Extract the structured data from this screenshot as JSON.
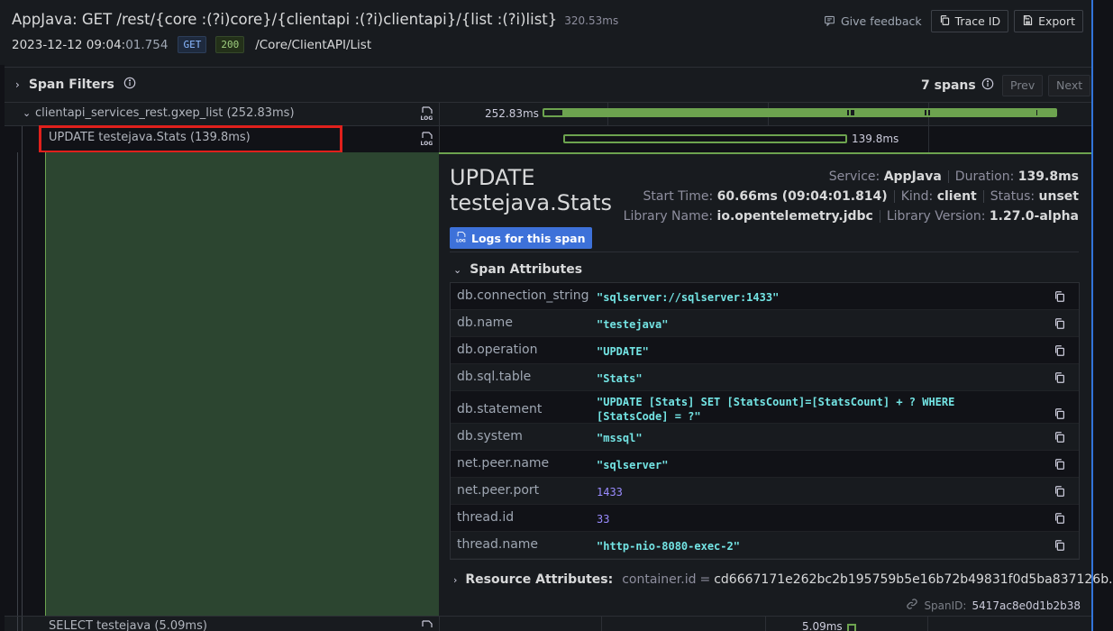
{
  "header": {
    "title": "AppJava: GET /rest/{core :(?i)core}/{clientapi :(?i)clientapi}/{list :(?i)list}",
    "duration": "320.53ms",
    "timestamp_main": "2023-12-12 09:04:",
    "timestamp_ms": "01.754",
    "method": "GET",
    "status_code": "200",
    "path": "/Core/ClientAPI/List",
    "feedback_label": "Give feedback",
    "trace_id_button": "Trace ID",
    "export_button": "Export"
  },
  "filters": {
    "label": "Span Filters",
    "span_count": "7 spans",
    "prev_label": "Prev",
    "next_label": "Next"
  },
  "spans": [
    {
      "name": "clientapi_services_rest.gxep_list (252.83ms)",
      "duration_label": "252.83ms"
    },
    {
      "name": "UPDATE testejava.Stats (139.8ms)",
      "duration_label": "139.8ms"
    },
    {
      "name": "SELECT testejava (5.09ms)",
      "duration_label": "5.09ms"
    }
  ],
  "detail": {
    "title": "UPDATE testejava.Stats",
    "service_label": "Service:",
    "service_value": "AppJava",
    "duration_label": "Duration:",
    "duration_value": "139.8ms",
    "start_label": "Start Time:",
    "start_value": "60.66ms (09:04:01.814)",
    "kind_label": "Kind:",
    "kind_value": "client",
    "status_label": "Status:",
    "status_value": "unset",
    "library_label": "Library Name:",
    "library_value": "io.opentelemetry.jdbc",
    "version_label": "Library Version:",
    "version_value": "1.27.0-alpha",
    "logs_button": "Logs for this span",
    "attributes_title": "Span Attributes",
    "attributes": [
      {
        "key": "db.connection_string",
        "value": "\"sqlserver://sqlserver:1433\""
      },
      {
        "key": "db.name",
        "value": "\"testejava\""
      },
      {
        "key": "db.operation",
        "value": "\"UPDATE\""
      },
      {
        "key": "db.sql.table",
        "value": "\"Stats\""
      },
      {
        "key": "db.statement",
        "value": "\"UPDATE [Stats] SET [StatsCount]=[StatsCount] + ? WHERE\n[StatsCode] = ?\""
      },
      {
        "key": "db.system",
        "value": "\"mssql\""
      },
      {
        "key": "net.peer.name",
        "value": "\"sqlserver\""
      },
      {
        "key": "net.peer.port",
        "value": "1433"
      },
      {
        "key": "thread.id",
        "value": "33"
      },
      {
        "key": "thread.name",
        "value": "\"http-nio-8080-exec-2\""
      }
    ],
    "resource_label": "Resource Attributes:",
    "resource_key": "container.id",
    "resource_eq": "=",
    "resource_value": "cd6667171e262bc2b195759b5e16b72b49831f0d5ba837126b...",
    "span_id_label": "SpanID:",
    "span_id_value": "5417ac8e0d1b2b38"
  },
  "colors": {
    "accent_green": "#6da34f",
    "highlight_red": "#e0201c",
    "primary_blue": "#3d71d9",
    "string_value": "#73e4e4",
    "number_value": "#9a8cff"
  },
  "icons": [
    "feedback-icon",
    "copy-icon",
    "export-icon",
    "info-icon",
    "chevron-right-icon",
    "chevron-down-icon",
    "log-icon",
    "link-icon"
  ]
}
